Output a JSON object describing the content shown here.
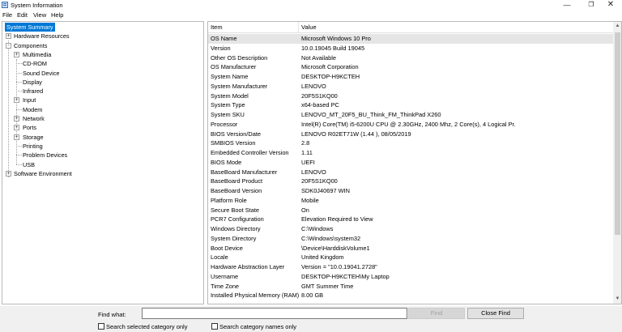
{
  "window": {
    "title": "System Information"
  },
  "menu": [
    "File",
    "Edit",
    "View",
    "Help"
  ],
  "tree": [
    {
      "label": "System Summary",
      "level": 0,
      "expander": "",
      "selected": true
    },
    {
      "label": "Hardware Resources",
      "level": 0,
      "expander": "+"
    },
    {
      "label": "Components",
      "level": 0,
      "expander": "-"
    },
    {
      "label": "Multimedia",
      "level": 1,
      "expander": "+"
    },
    {
      "label": "CD-ROM",
      "level": 1,
      "expander": ""
    },
    {
      "label": "Sound Device",
      "level": 1,
      "expander": ""
    },
    {
      "label": "Display",
      "level": 1,
      "expander": ""
    },
    {
      "label": "Infrared",
      "level": 1,
      "expander": ""
    },
    {
      "label": "Input",
      "level": 1,
      "expander": "+"
    },
    {
      "label": "Modem",
      "level": 1,
      "expander": ""
    },
    {
      "label": "Network",
      "level": 1,
      "expander": "+"
    },
    {
      "label": "Ports",
      "level": 1,
      "expander": "+"
    },
    {
      "label": "Storage",
      "level": 1,
      "expander": "+"
    },
    {
      "label": "Printing",
      "level": 1,
      "expander": ""
    },
    {
      "label": "Problem Devices",
      "level": 1,
      "expander": ""
    },
    {
      "label": "USB",
      "level": 1,
      "expander": ""
    },
    {
      "label": "Software Environment",
      "level": 0,
      "expander": "+"
    }
  ],
  "table": {
    "headers": {
      "item": "Item",
      "value": "Value"
    },
    "rows": [
      {
        "item": "OS Name",
        "value": "Microsoft Windows 10 Pro",
        "highlight": true
      },
      {
        "item": "Version",
        "value": "10.0.19045 Build 19045"
      },
      {
        "item": "Other OS Description",
        "value": "Not Available"
      },
      {
        "item": "OS Manufacturer",
        "value": "Microsoft Corporation"
      },
      {
        "item": "System Name",
        "value": "DESKTOP-H9KCTEH"
      },
      {
        "item": "System Manufacturer",
        "value": "LENOVO"
      },
      {
        "item": "System Model",
        "value": "20F5S1KQ00"
      },
      {
        "item": "System Type",
        "value": "x64-based PC"
      },
      {
        "item": "System SKU",
        "value": "LENOVO_MT_20F5_BU_Think_FM_ThinkPad X260"
      },
      {
        "item": "Processor",
        "value": "Intel(R) Core(TM) i5-6200U CPU @ 2.30GHz, 2400 Mhz, 2 Core(s), 4 Logical Pr..."
      },
      {
        "item": "BIOS Version/Date",
        "value": "LENOVO R02ET71W (1.44 ), 08/05/2019"
      },
      {
        "item": "SMBIOS Version",
        "value": "2.8"
      },
      {
        "item": "Embedded Controller Version",
        "value": "1.11"
      },
      {
        "item": "BIOS Mode",
        "value": "UEFI"
      },
      {
        "item": "BaseBoard Manufacturer",
        "value": "LENOVO"
      },
      {
        "item": "BaseBoard Product",
        "value": "20F5S1KQ00"
      },
      {
        "item": "BaseBoard Version",
        "value": "SDK0J40697 WIN"
      },
      {
        "item": "Platform Role",
        "value": "Mobile"
      },
      {
        "item": "Secure Boot State",
        "value": "On"
      },
      {
        "item": "PCR7 Configuration",
        "value": "Elevation Required to View"
      },
      {
        "item": "Windows Directory",
        "value": "C:\\Windows"
      },
      {
        "item": "System Directory",
        "value": "C:\\Windows\\system32"
      },
      {
        "item": "Boot Device",
        "value": "\\Device\\HarddiskVolume1"
      },
      {
        "item": "Locale",
        "value": "United Kingdom"
      },
      {
        "item": "Hardware Abstraction Layer",
        "value": "Version = \"10.0.19041.2728\""
      },
      {
        "item": "Username",
        "value": "DESKTOP-H9KCTEH\\My Laptop"
      },
      {
        "item": "Time Zone",
        "value": "GMT Summer Time"
      },
      {
        "item": "Installed Physical Memory (RAM)",
        "value": "8.00 GB"
      }
    ]
  },
  "find": {
    "label": "Find what:",
    "value": "",
    "find_button": "Find",
    "close_button": "Close Find",
    "check_selected_category": "Search selected category only",
    "check_category_names": "Search category names only"
  }
}
